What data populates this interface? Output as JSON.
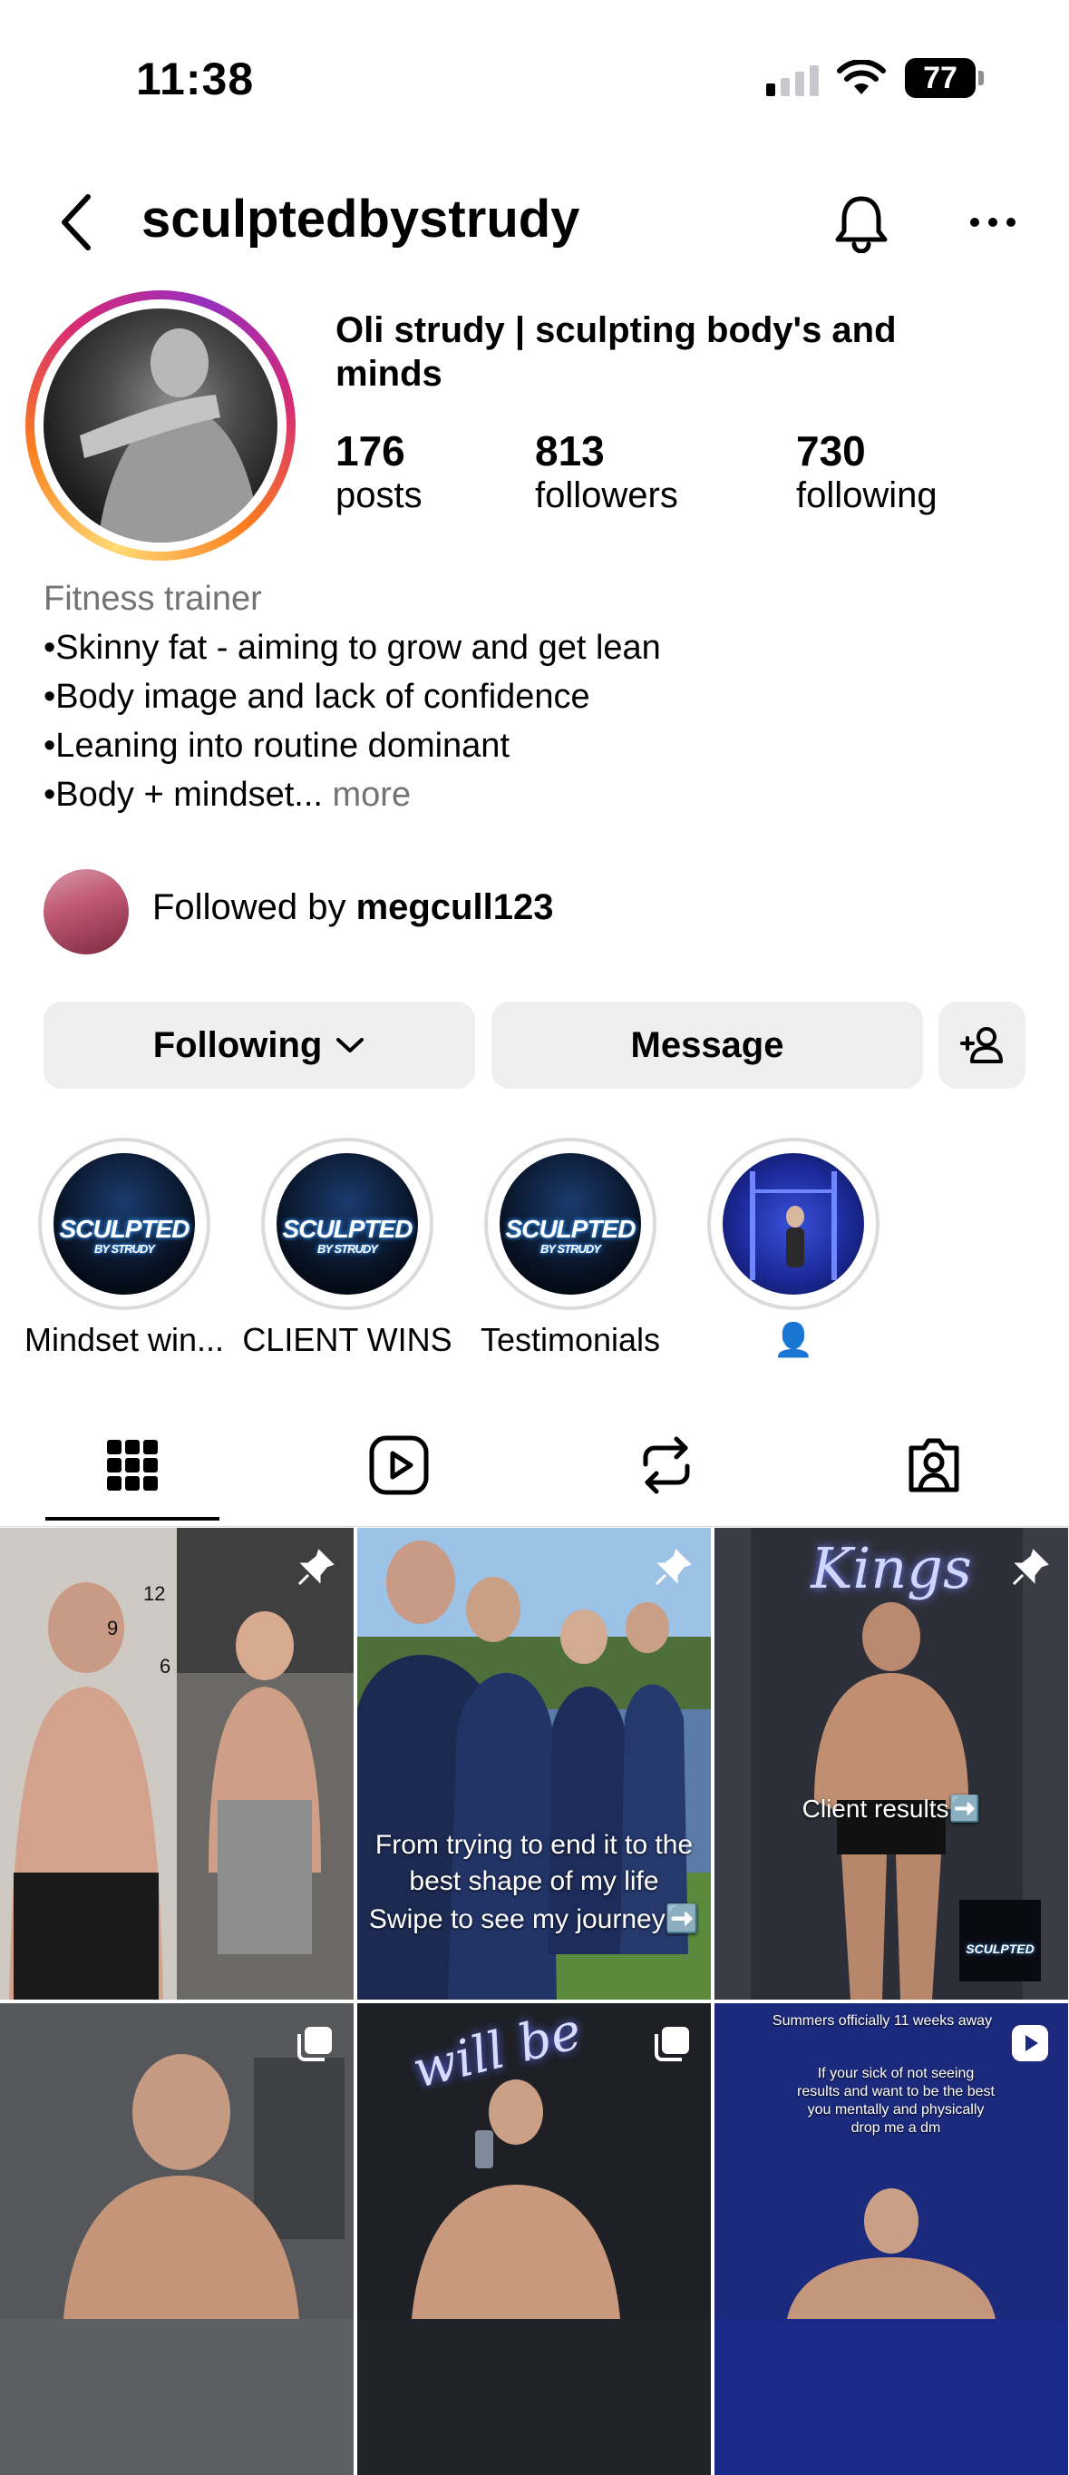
{
  "status_bar": {
    "time": "11:38",
    "battery": "77"
  },
  "header": {
    "username": "sculptedbystrudy"
  },
  "profile": {
    "display_name": "Oli strudy | sculpting body's and minds",
    "stats": [
      {
        "value": "176",
        "label": "posts"
      },
      {
        "value": "813",
        "label": "followers"
      },
      {
        "value": "730",
        "label": "following"
      }
    ],
    "category": "Fitness trainer",
    "bio_lines": [
      "•Skinny fat - aiming to grow and get lean",
      "•Body image and lack of confidence",
      "•Leaning into routine dominant",
      "•Body + mindset..."
    ],
    "bio_more": "more",
    "followed_by_prefix": "Followed by ",
    "followed_by_user": "megcull123"
  },
  "actions": {
    "following": "Following",
    "message": "Message"
  },
  "highlights": [
    {
      "label": "Mindset win...",
      "logo": "SCULPTED",
      "logo_sub": "BY STRUDY"
    },
    {
      "label": "CLIENT WINS",
      "logo": "SCULPTED",
      "logo_sub": "BY STRUDY"
    },
    {
      "label": "Testimonials",
      "logo": "SCULPTED",
      "logo_sub": "BY STRUDY"
    },
    {
      "label": "👤"
    }
  ],
  "tabs": [
    "grid-icon",
    "reels-icon",
    "reposts-icon",
    "tagged-icon"
  ],
  "posts": [
    {
      "caption": "",
      "pinned": true,
      "clock_labels": [
        "12",
        "9",
        "6"
      ]
    },
    {
      "caption": "From trying to end it to the best shape of my life",
      "caption2": "Swipe to see my journey➡️",
      "pinned": true
    },
    {
      "caption": "Client results➡️",
      "pinned": true,
      "overlay_text": "Kings",
      "badge": "SCULPTED"
    },
    {
      "caption": "",
      "type": "carousel"
    },
    {
      "caption": "",
      "type": "carousel",
      "overlay_text": "will be"
    },
    {
      "caption": "Summers officially 11 weeks away",
      "caption2": "If your sick of not seeing results and want to be the best you mentally and physically drop me a dm",
      "type": "reel"
    }
  ]
}
